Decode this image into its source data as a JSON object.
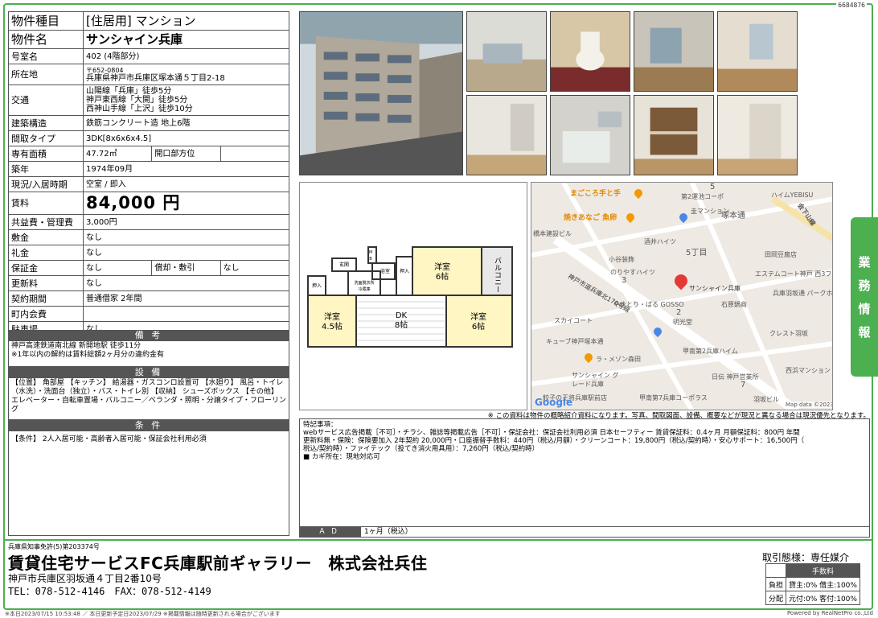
{
  "doc_id": "6684876",
  "property": {
    "type_label": "物件種目",
    "type_value": "[住居用] マンション",
    "name_label": "物件名",
    "name_value": "サンシャイン兵庫",
    "room_label": "号室名",
    "room_value": "402 (4階部分)",
    "location_label": "所在地",
    "zip": "〒652-0804",
    "address": "兵庫県神戸市兵庫区塚本通５丁目2-18",
    "access_label": "交通",
    "access_lines": [
      "山陽線「兵庫」徒歩5分",
      "神戸東西線「大開」徒歩5分",
      "西神山手線「上沢」徒歩10分"
    ],
    "structure_label": "建築構造",
    "structure_value": "鉄筋コンクリート造 地上6階",
    "layout_label": "間取タイプ",
    "layout_value": "3DK[8x6x6x4.5]",
    "area_label": "専有面積",
    "area_value": "47.72㎡",
    "direction_label": "開口部方位",
    "direction_value": "",
    "built_label": "築年",
    "built_value": "1974年09月",
    "status_label": "現況/入居時期",
    "status_value": "空室 / 即入",
    "rent_label": "賃料",
    "rent_value": "84,000 円",
    "fee_label": "共益費・管理費",
    "fee_value": "3,000円",
    "deposit_label": "敷金",
    "deposit_value": "なし",
    "key_money_label": "礼金",
    "key_money_value": "なし",
    "guarantee_label": "保証金",
    "guarantee_value": "なし",
    "amort_label": "償却・敷引",
    "amort_value": "なし",
    "renewal_label": "更新料",
    "renewal_value": "なし",
    "contract_label": "契約期間",
    "contract_value": "普通借家 2年間",
    "association_label": "町内会費",
    "association_value": "",
    "parking_label": "駐車場",
    "parking_value": "なし"
  },
  "remarks": {
    "title": "備 考",
    "lines": [
      "神戸高速鉄道南北線 新開地駅 徒歩11分",
      "※1年以内の解約は賃料総額2ヶ月分の違約金有"
    ]
  },
  "facilities": {
    "title": "設 備",
    "text": "【位置】 角部屋 【キッチン】 給湯器・ガスコンロ設置可 【水廻り】 風呂・トイレ（水洗）・洗面台（独立）・バス・トイレ別 【収納】 シューズボックス 【その他】 エレベーター・自転車置場・バルコニー／ベランダ・照明・分譲タイプ・フローリング"
  },
  "conditions": {
    "title": "条 件",
    "text": "【条件】 2人入居可能・高齢者入居可能・保証会社利用必須"
  },
  "floorplan": {
    "rooms": [
      {
        "name": "洋室",
        "size": "6帖"
      },
      {
        "name": "洋室",
        "size": "4.5帖"
      },
      {
        "name": "DK",
        "size": "8帖"
      },
      {
        "name": "洋室",
        "size": "6帖"
      }
    ],
    "balcony": "バルコニー",
    "small": [
      "浴室",
      "押入",
      "押入",
      "玄関",
      "洗面脱衣所",
      "冷蔵庫",
      "M",
      "B"
    ]
  },
  "map": {
    "labels": {
      "kokoro": "まごころ手と手",
      "yakianago": "焼きあなご 魚卵",
      "hashimoto": "橋本建設ビル",
      "tsukamoto": "塚本通",
      "chome5": "5丁目",
      "kyuto": "第2運池コーポ",
      "maru": "圭マンション",
      "haim": "ハイムYEBISU",
      "shimo": "会下山線",
      "sakai": "酒井ハイツ",
      "kotani": "小谷装飾",
      "tamura": "田岡豆腐店",
      "noriyasu": "のりやすハイツ",
      "num3": "3",
      "sunshine": "サンシャイン兵庫",
      "estem": "エステムコート神戸 西3フロンタージュ",
      "hyogo_park": "兵庫羽坂通 パークホームズ",
      "ishihara": "石原鍋商",
      "yakitori": "やきとり・ばる GOSSO",
      "num2": "2",
      "meiko": "明光堂",
      "route": "神戸市道兵庫北170号線",
      "skycoat": "スカイコート",
      "crest": "クレスト羽坂",
      "cube": "キューブ神戸塚本通",
      "heim_south": "甲南第2兵庫ハイム",
      "maison": "ラ・メゾン森田",
      "nisshin": "日伝 神戸営業所",
      "num7": "7",
      "nishihama": "西浜マンション",
      "sunshine_green": "サンシャイン グレード兵庫",
      "kaminami": "甲南第7兵庫コーポラス",
      "oki": "餃子の王将兵庫駅前店",
      "hasaka": "羽坂ビル",
      "num5": "5",
      "google": "Google",
      "copyright": "Map data ©2023"
    }
  },
  "notice": "※ この資料は物件の概略紹介資料になります。写真、間取図面、設備、概要などが現況と異なる場合は現況優先となります。",
  "special": {
    "title": "特記事項：",
    "lines": [
      "webサービス広告掲載［不可］・チラシ、雑誌等掲載広告［不可］・保証会社：保証会社利用必須 日本セーフティー 賃貸保証料：0.4ヶ月 月額保証料：800円 年間",
      "更新料無・保険：保険要加入 2年契約 20,000円・口座振替手数料：440円（税込/月額）・クリーンコート：19,800円（税込/契約時）・安心サポート：16,500円（",
      "税込/契約時）・ファイテック（投てき消火用具用）：7,260円（税込/契約時）",
      "■ カギ所在：現地対応可"
    ]
  },
  "ad": {
    "label": "ＡＤ",
    "value": "1ヶ月（税込）"
  },
  "side_tab": [
    "業",
    "務",
    "情",
    "報"
  ],
  "footer": {
    "license": "兵庫県知事免許(5)第203374号",
    "company": "賃貸住宅サービスFC兵庫駅前ギャラリー　株式会社兵住",
    "address": "神戸市兵庫区羽坂通４丁目2番10号",
    "tel": "TEL：078-512-4146　FAX：078-512-4149",
    "deal_type": "取引態様：専任媒介",
    "fee_header": "手数料",
    "fee_rows": [
      {
        "k": "負担",
        "v": "貸主:0% 借主:100%"
      },
      {
        "k": "分配",
        "v": "元付:0% 客付:100%"
      }
    ],
    "bottom_left": "※本日2023/07/15 10:53:48 ／ 本日更新予定日2023/07/29 ※掲載情報は随時更新される場合がございます",
    "bottom_right": "Powered by RealNetPro co.,Ltd"
  },
  "colors": {
    "accent": "#4caf50",
    "header_bar": "#555555"
  }
}
